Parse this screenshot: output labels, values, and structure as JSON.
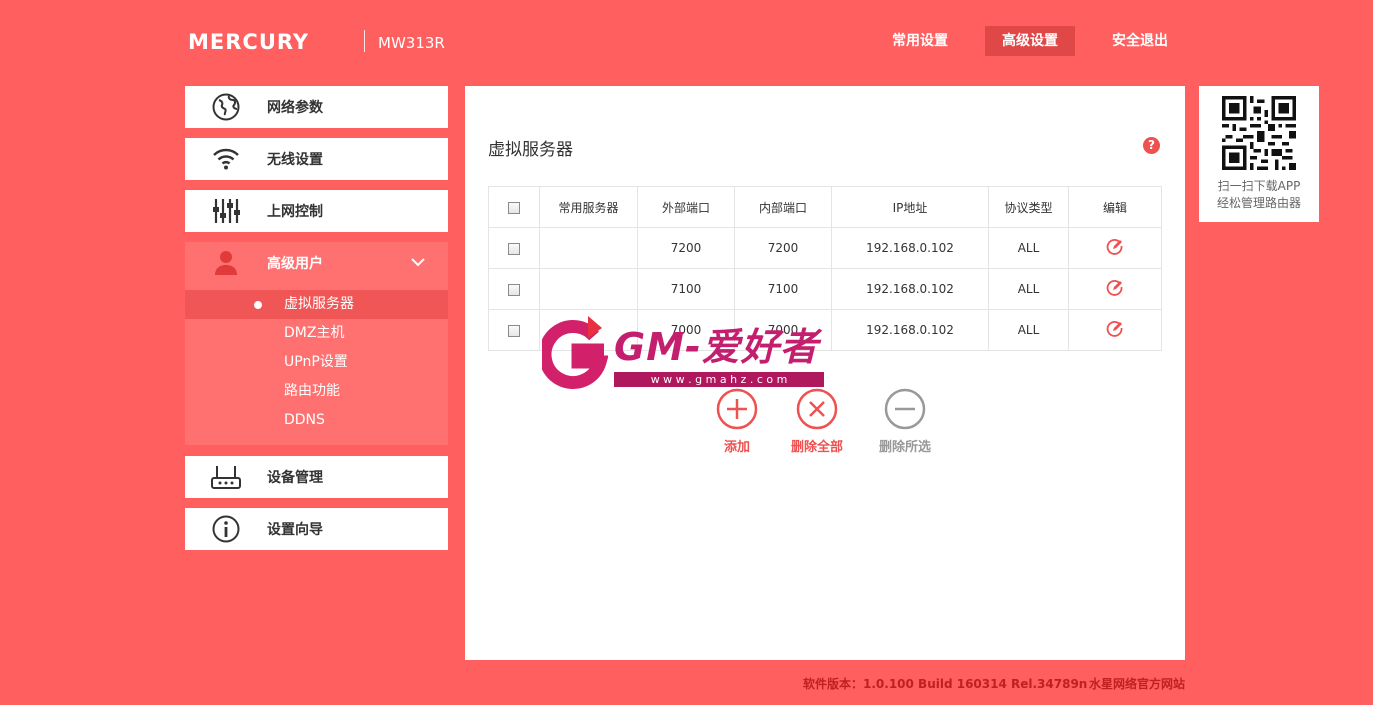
{
  "header": {
    "brand": "MERCURY",
    "model": "MW313R",
    "nav": {
      "common": "常用设置",
      "advanced": "高级设置",
      "logout": "安全退出"
    }
  },
  "sidebar": {
    "items": [
      {
        "label": "网络参数",
        "icon": "globe-icon"
      },
      {
        "label": "无线设置",
        "icon": "wifi-icon"
      },
      {
        "label": "上网控制",
        "icon": "sliders-icon"
      },
      {
        "label": "高级用户",
        "icon": "user-icon",
        "expanded": true
      },
      {
        "label": "设备管理",
        "icon": "router-icon"
      },
      {
        "label": "设置向导",
        "icon": "info-icon"
      }
    ],
    "submenu": [
      "虚拟服务器",
      "DMZ主机",
      "UPnP设置",
      "路由功能",
      "DDNS"
    ],
    "active_sub": "虚拟服务器"
  },
  "main": {
    "title": "虚拟服务器",
    "help": "?",
    "table": {
      "headers": [
        "常用服务器",
        "外部端口",
        "内部端口",
        "IP地址",
        "协议类型",
        "编辑"
      ],
      "rows": [
        {
          "service": "",
          "ext": "7200",
          "int": "7200",
          "ip": "192.168.0.102",
          "proto": "ALL"
        },
        {
          "service": "",
          "ext": "7100",
          "int": "7100",
          "ip": "192.168.0.102",
          "proto": "ALL"
        },
        {
          "service": "",
          "ext": "7000",
          "int": "7000",
          "ip": "192.168.0.102",
          "proto": "ALL"
        }
      ]
    },
    "buttons": {
      "add": "添加",
      "delete_all": "删除全部",
      "delete_selected": "删除所选"
    }
  },
  "watermark": {
    "text": "GM-爱好者",
    "url": "w w w . g m a h z . c o m"
  },
  "qr": {
    "line1": "扫一扫下载APP",
    "line2": "经松管理路由器"
  },
  "footer": {
    "version": "软件版本：1.0.100 Build 160314 Rel.34789n",
    "site": "水星网络官方网站"
  },
  "colors": {
    "background": "#ff5f5f",
    "accent": "#ef5050",
    "active_nav": "#e04848",
    "submenu_bg": "#ff7070",
    "disabled": "#999999"
  }
}
